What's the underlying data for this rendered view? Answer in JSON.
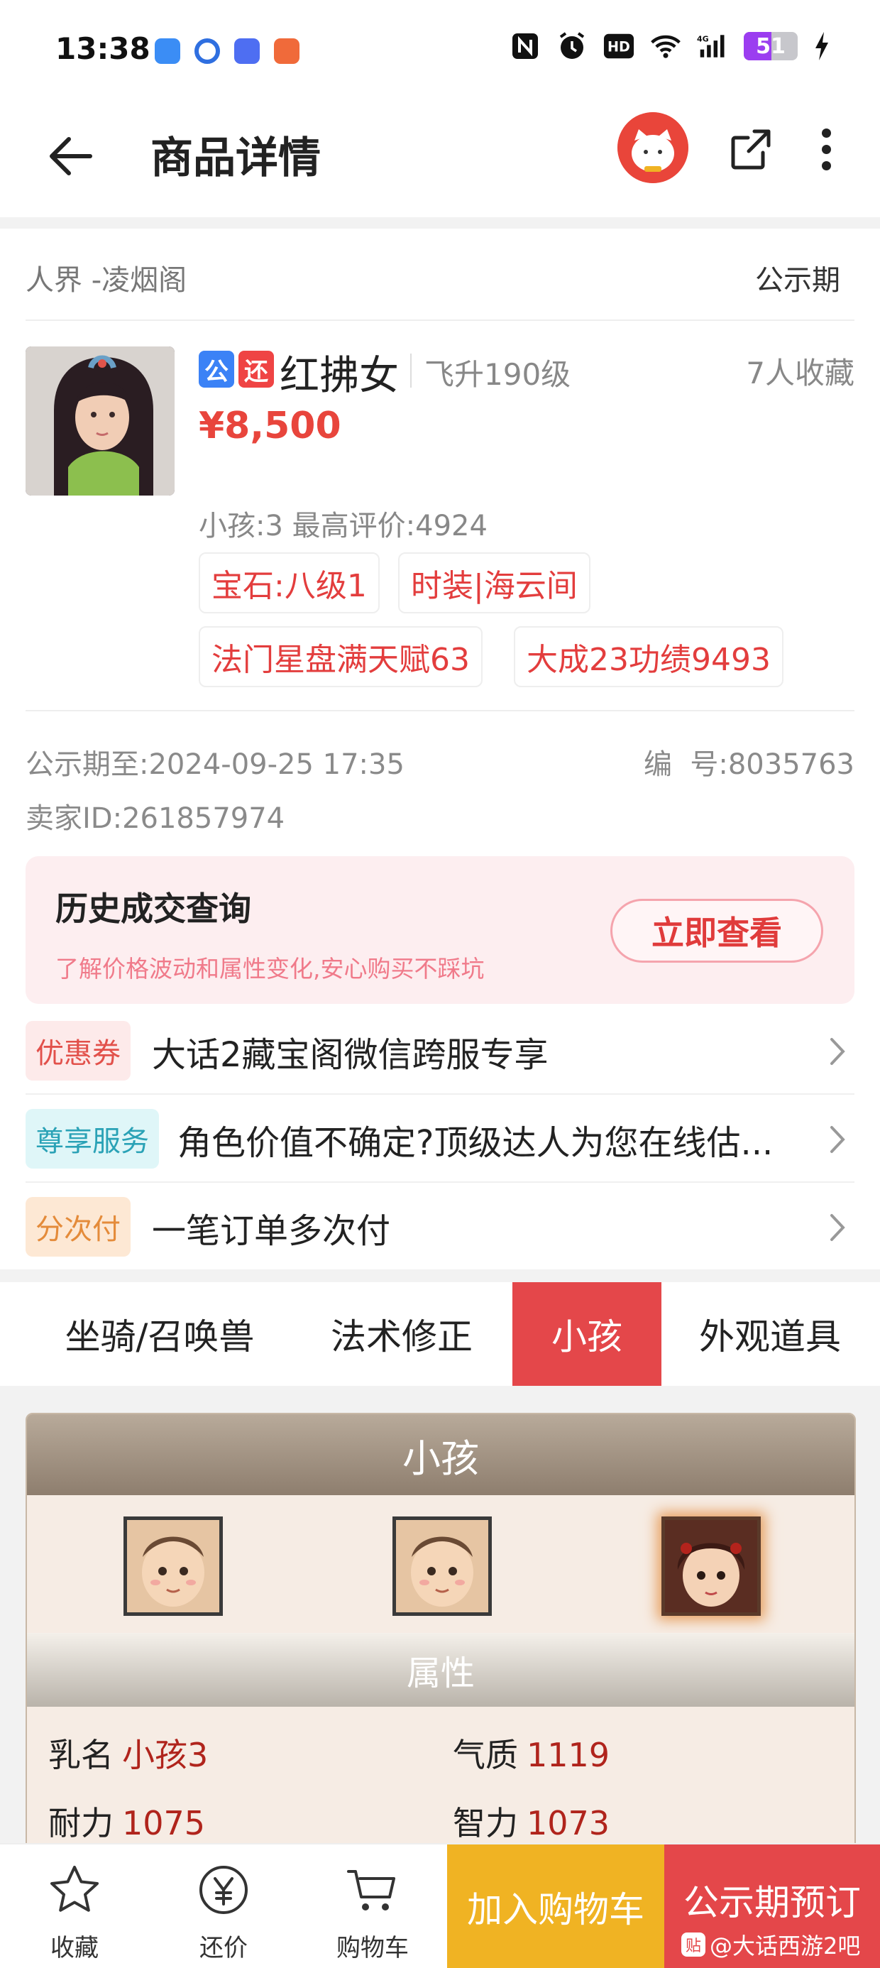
{
  "status_bar": {
    "time": "13:38",
    "network": "4G",
    "hd": "HD",
    "battery": "51",
    "battery_level": 0.51,
    "icons": [
      "nfc-icon",
      "alarm-icon",
      "hd-icon",
      "wifi-icon",
      "signal-icon",
      "battery-icon",
      "charging-icon"
    ]
  },
  "app_bar": {
    "title": "商品详情",
    "back_icon": "back-arrow-icon",
    "share_icon": "share-icon",
    "more_icon": "more-vertical-icon"
  },
  "server": {
    "name": "人界 -凌烟阁",
    "status": "公示期"
  },
  "product": {
    "badge_public": "公",
    "badge_bargain": "还",
    "name": "红拂女",
    "level": "飞升190级",
    "favorites": "7人收藏",
    "price": "¥8,500",
    "child_info": "小孩:3 最高评价:4924",
    "tags": [
      "宝石:八级1",
      "时装|海云间",
      "法门星盘满天赋63",
      "大成23功绩9493"
    ]
  },
  "meta": {
    "public_until_label": "公示期至:",
    "public_until": "2024-09-25 17:35",
    "number_label": "编  号:",
    "number": "8035763",
    "seller_label": "卖家ID:",
    "seller_id": "261857974"
  },
  "history": {
    "title": "历史成交查询",
    "subtitle": "了解价格波动和属性变化,安心购买不踩坑",
    "button": "立即查看"
  },
  "promos": [
    {
      "tag": "优惠券",
      "text": "大话2藏宝阁微信跨服专享"
    },
    {
      "tag": "尊享服务",
      "text": "角色价值不确定?顶级达人为您在线估..."
    },
    {
      "tag": "分次付",
      "text": "一笔订单多次付"
    }
  ],
  "tabs": [
    "坐骑/召唤兽",
    "法术修正",
    "小孩",
    "外观道具"
  ],
  "active_tab": "小孩",
  "child_panel": {
    "title": "小孩",
    "attributes_title": "属性",
    "attributes": [
      {
        "label": "乳名",
        "value": "小孩3"
      },
      {
        "label": "气质",
        "value": "1119"
      },
      {
        "label": "耐力",
        "value": "1075"
      },
      {
        "label": "智力",
        "value": "1073"
      }
    ]
  },
  "bottom_bar": {
    "favorite": "收藏",
    "bargain": "还价",
    "cart": "购物车",
    "add_to_cart": "加入购物车",
    "reserve": "公示期预订"
  },
  "watermark": {
    "logo": "贴",
    "text": "@大话西游2吧"
  },
  "colors": {
    "accent_red": "#e4474a",
    "price_red": "#e8453c",
    "cart_yellow": "#f0b323",
    "history_bg": "#fdeef0"
  }
}
